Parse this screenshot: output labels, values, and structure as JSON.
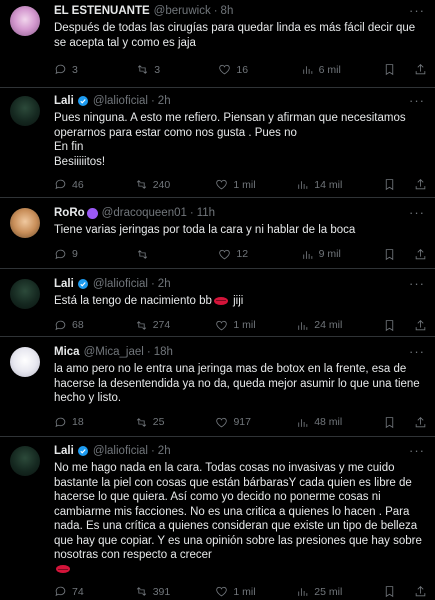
{
  "colors": {
    "background": "#000000",
    "text": "#e7e9ea",
    "muted": "#71767b",
    "divider": "#2f3336",
    "verified": "#1d9bf0",
    "lips": "#d4143a"
  },
  "tweets": [
    {
      "name": "EL ESTENUANTE",
      "handle": "@beruwick",
      "time": "8h",
      "verified": false,
      "text": "Después de todas las cirugías para quedar linda es más fácil decir que se acepta tal y como es jaja",
      "replies": "3",
      "retweets": "3",
      "likes": "16",
      "views": "6 mil"
    },
    {
      "name": "Lali",
      "handle": "@lalioficial",
      "time": "2h",
      "verified": true,
      "text": "Pues ninguna. A esto me refiero. Piensan y afirman que necesitamos operarnos para estar como nos gusta . Pues no\nEn fin\nBesiiiiitos!",
      "replies": "46",
      "retweets": "240",
      "likes": "1 mil",
      "views": "14 mil"
    },
    {
      "name": "RoRo",
      "handle": "@dracoqueen01",
      "time": "11h",
      "verified": false,
      "text": "Tiene varias jeringas por toda la cara y ni hablar de la boca",
      "replies": "9",
      "retweets": "",
      "likes": "12",
      "views": "9 mil"
    },
    {
      "name": "Lali",
      "handle": "@lalioficial",
      "time": "2h",
      "verified": true,
      "text": "Está la tengo de nacimiento bb",
      "text_suffix": " jiji",
      "replies": "68",
      "retweets": "274",
      "likes": "1 mil",
      "views": "24 mil"
    },
    {
      "name": "Mica",
      "handle": "@Mica_jael",
      "time": "18h",
      "verified": false,
      "text": "la amo pero no le entra una jeringa mas de botox en la frente, esa de hacerse la desentendida ya no da, queda mejor asumir lo que una tiene hecho y listo.",
      "replies": "18",
      "retweets": "25",
      "likes": "917",
      "views": "48 mil"
    },
    {
      "name": "Lali",
      "handle": "@lalioficial",
      "time": "2h",
      "verified": true,
      "text": "No me hago nada en la cara. Todas cosas no invasivas y me cuido bastante la piel con cosas que están bárbarasY cada quien es libre de hacerse lo que quiera. Así como yo decido no ponerme cosas ni cambiarme mis facciones. No es una critica a quienes lo hacen . Para nada. Es una crítica a quienes consideran que existe un tipo de belleza que hay que copiar. Y es una opinión sobre las presiones que hay sobre nosotras con respecto a crecer",
      "replies": "74",
      "retweets": "391",
      "likes": "1 mil",
      "views": "25 mil"
    }
  ]
}
